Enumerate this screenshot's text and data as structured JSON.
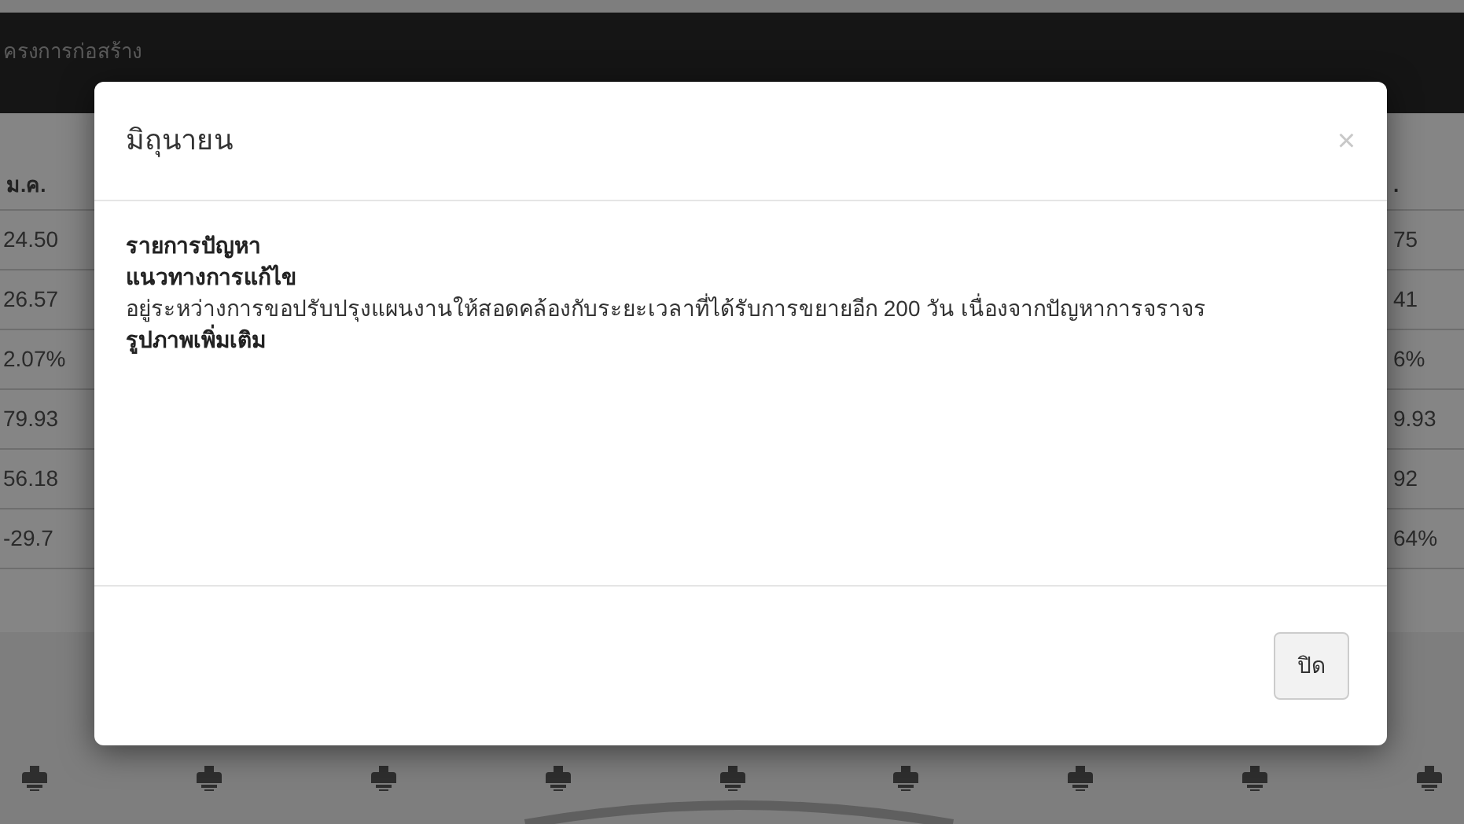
{
  "page": {
    "header_title": "ครงการก่อสร้าง",
    "table": {
      "left_column": {
        "heading": "ม.ค.",
        "cells": [
          "24.50",
          "26.57",
          "2.07%",
          "79.93",
          "56.18",
          "-29.7"
        ]
      },
      "right_column": {
        "heading": ".",
        "cells": [
          "75",
          "41",
          "6%",
          "9.93",
          "92",
          "64%"
        ]
      }
    }
  },
  "modal": {
    "title": "มิถุนายน",
    "close": "×",
    "sections": [
      {
        "kind": "heading",
        "text": "รายการปัญหา"
      },
      {
        "kind": "heading",
        "text": "แนวทางการแก้ไข"
      },
      {
        "kind": "text",
        "text": "อยู่ระหว่างการขอปรับปรุงแผนงานให้สอดคล้องกับระยะเวลาที่ได้รับการขยายอีก 200 วัน เนื่องจากปัญหาการจราจร"
      },
      {
        "kind": "heading",
        "text": "รูปภาพเพิ่มเติม"
      }
    ],
    "button": "ปิด"
  }
}
